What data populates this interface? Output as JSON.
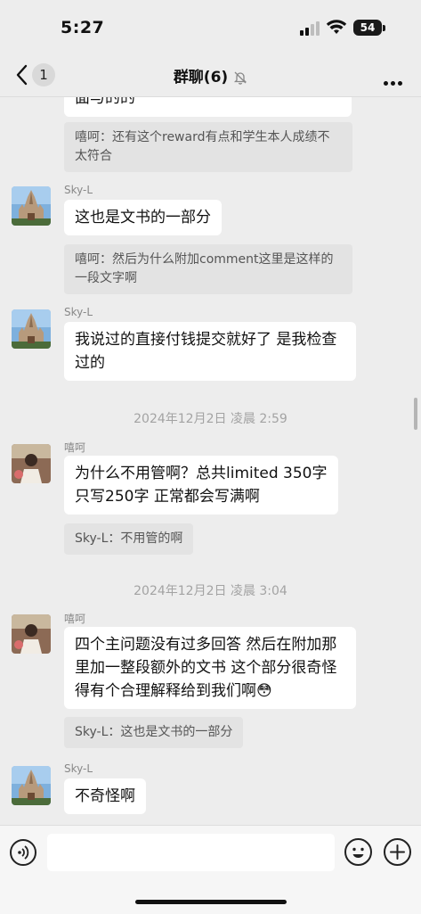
{
  "status_bar": {
    "time": "5:27",
    "battery": "54"
  },
  "nav": {
    "back_count": "1",
    "title": "群聊(6)"
  },
  "messages": {
    "m0_partial": "面与的的",
    "q0": "嘻呵：还有这个reward有点和学生本人成绩不太符合",
    "m1_sender": "Sky-L",
    "m1": "这也是文书的一部分",
    "q1": "嘻呵：然后为什么附加comment这里是这样的一段文字啊",
    "m2_sender": "Sky-L",
    "m2": "我说过的直接付钱提交就好了 是我检查过的",
    "ts1": "2024年12月2日 凌晨 2:59",
    "m3_sender": "嘻呵",
    "m3": "为什么不用管啊？总共limited 350字 只写250字 正常都会写满啊",
    "q3": "Sky-L：不用管的啊",
    "ts2": "2024年12月2日 凌晨 3:04",
    "m4_sender": "嘻呵",
    "m4": "四个主问题没有过多回答 然后在附加那里加一整段额外的文书 这个部分很奇怪 得有个合理解释给到我们啊😳",
    "q4": "Sky-L：这也是文书的一部分",
    "m5_sender": "Sky-L",
    "m5": "不奇怪啊"
  },
  "input": {
    "placeholder": ""
  },
  "icons": {
    "back": "chevron-left-icon",
    "mute": "bell-off-icon",
    "more": "more-dots-icon",
    "voice": "voice-icon",
    "emoji": "emoji-icon",
    "plus": "plus-icon"
  }
}
